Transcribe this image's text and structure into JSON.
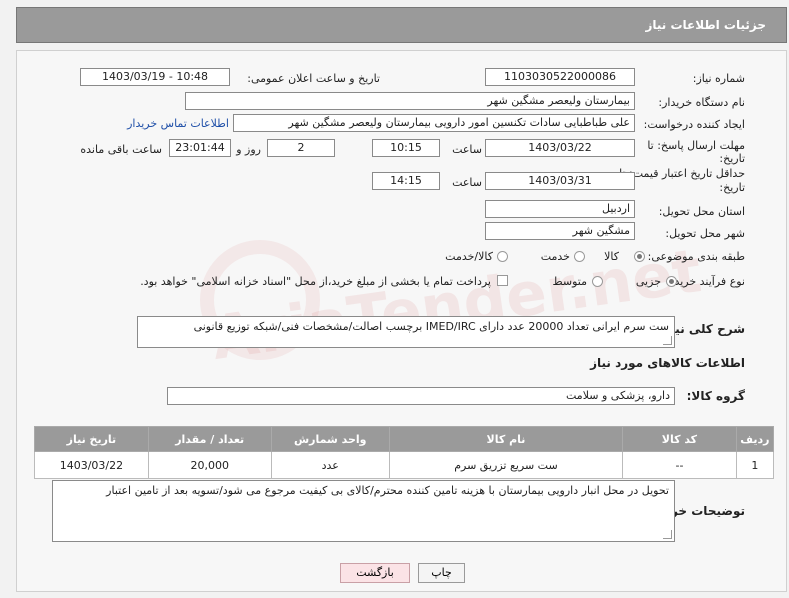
{
  "header": {
    "title": "جزئیات اطلاعات نیاز"
  },
  "form": {
    "need_number_label": "شماره نیاز:",
    "need_number": "1103030522000086",
    "announce_label": "تاریخ و ساعت اعلان عمومی:",
    "announce_value": "1403/03/19 - 10:48",
    "buyer_org_label": "نام دستگاه خریدار:",
    "buyer_org": "بیمارستان ولیعصر مشگین شهر",
    "creator_label": "ایجاد کننده درخواست:",
    "creator": "علی طباطبایی سادات تکنسین امور دارویی بیمارستان ولیعصر مشگین شهر",
    "contact_link": "اطلاعات تماس خریدار",
    "deadline_label_line1": "مهلت ارسال پاسخ: تا",
    "deadline_label_line2": "تاریخ:",
    "deadline_date": "1403/03/22",
    "time_label": "ساعت",
    "deadline_time": "10:15",
    "days_value": "2",
    "days_label": "روز و",
    "remaining_time": "23:01:44",
    "remaining_label": "ساعت باقی مانده",
    "min_validity_line1": "حداقل تاریخ اعتبار قیمت: تا",
    "min_validity_line2": "تاریخ:",
    "validity_date": "1403/03/31",
    "validity_time": "14:15",
    "province_label": "استان محل تحویل:",
    "province": "اردبیل",
    "city_label": "شهر محل تحویل:",
    "city": "مشگین شهر",
    "category_label": "طبقه بندی موضوعی:",
    "category_options": [
      "کالا",
      "خدمت",
      "کالا/خدمت"
    ],
    "process_label": "نوع فرآیند خرید :",
    "process_options": [
      "جزیی",
      "متوسط"
    ],
    "payment_note": "پرداخت تمام یا بخشی از مبلغ خرید،از محل \"اسناد خزانه اسلامی\" خواهد بود."
  },
  "description": {
    "label": "شرح کلی نیاز:",
    "text": "ست سرم ایرانی تعداد 20000 عدد دارای IMED/IRC برچسب اصالت/مشخصات فنی/شبکه توزیع قانونی"
  },
  "goods": {
    "section_title": "اطلاعات کالاهای مورد نیاز",
    "group_label": "گروه کالا:",
    "group_value": "دارو، پزشکی و سلامت",
    "columns": [
      "ردیف",
      "کد کالا",
      "نام کالا",
      "واحد شمارش",
      "تعداد / مقدار",
      "تاریخ نیاز"
    ],
    "rows": [
      {
        "row": "1",
        "code": "--",
        "name": "ست سریع تزریق سرم",
        "unit": "عدد",
        "qty": "20,000",
        "date": "1403/03/22"
      }
    ]
  },
  "buyer_notes": {
    "label": "توضیحات خریدار:",
    "text": "تحویل در محل انبار دارویی بیمارستان با هزینه تامین کننده محترم/کالای بی کیفیت مرجوع می شود/تسویه بعد از تامین اعتبار"
  },
  "buttons": {
    "print": "چاپ",
    "back": "بازگشت"
  },
  "colors": {
    "header_bg": "#9a9a9a",
    "link": "#1f4fa8",
    "back_btn_bg": "#fbe3e6"
  }
}
